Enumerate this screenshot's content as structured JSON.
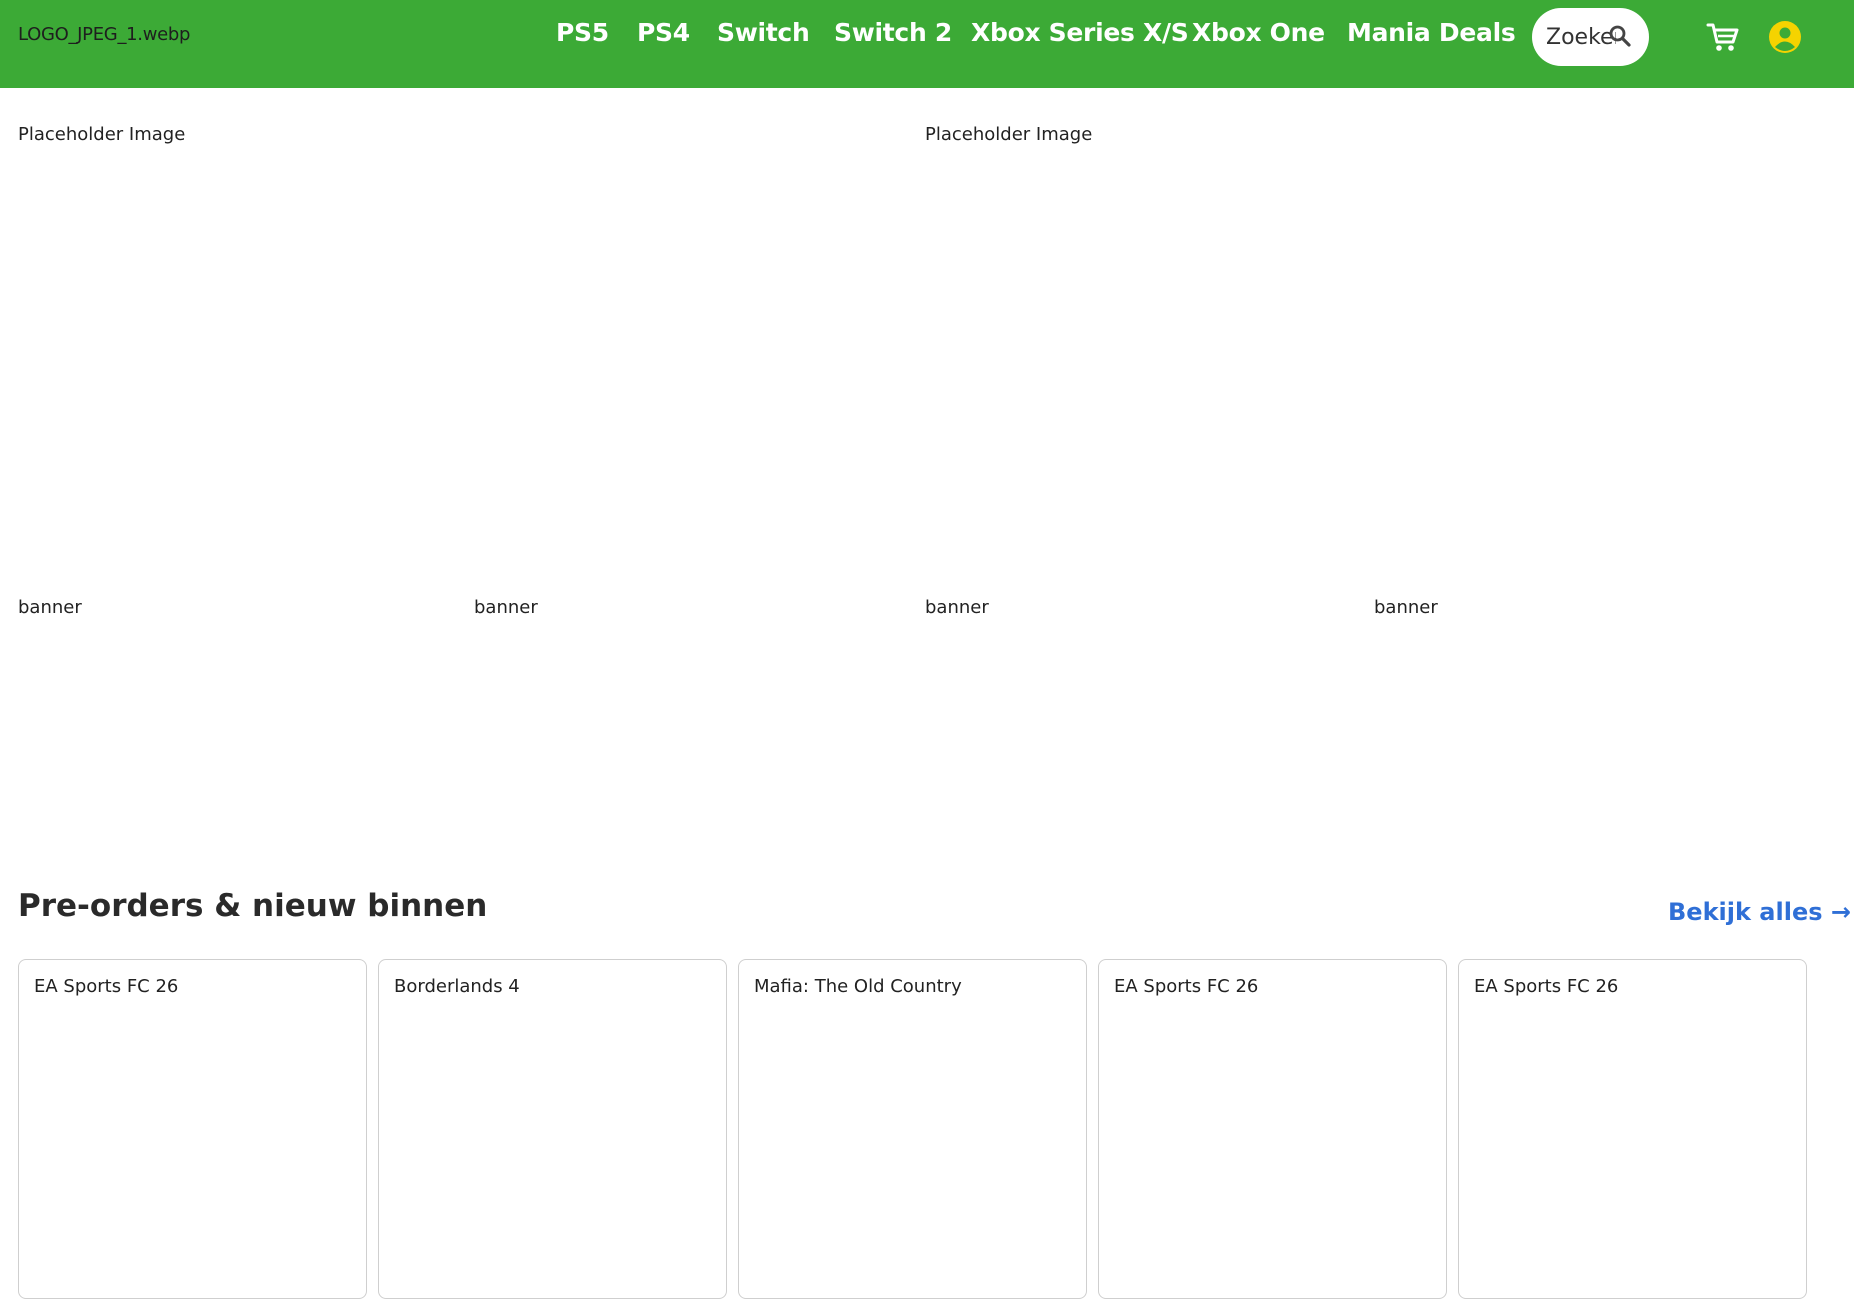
{
  "header": {
    "logo_alt": "LOGO_JPEG_1.webp",
    "background_color": "#3caa36",
    "nav": [
      {
        "label": "PS5"
      },
      {
        "label": "PS4"
      },
      {
        "label": "Switch"
      },
      {
        "label": "Switch 2"
      },
      {
        "label": "Xbox Series X/S"
      },
      {
        "label": "Xbox One"
      },
      {
        "label": "Mania Deals"
      }
    ],
    "search": {
      "placeholder": "Zoeken",
      "value": "",
      "icon": "search-icon"
    },
    "cart_icon": "cart-icon",
    "user_icon": "user-icon",
    "user_icon_color": "#f5d300"
  },
  "hero": {
    "images": [
      {
        "alt": "Placeholder Image"
      },
      {
        "alt": "Placeholder Image"
      }
    ],
    "banners": [
      {
        "alt": "banner"
      },
      {
        "alt": "banner"
      },
      {
        "alt": "banner"
      },
      {
        "alt": "banner"
      }
    ]
  },
  "section": {
    "title": "Pre-orders & nieuw binnen",
    "see_all_label": "Bekijk alles →",
    "link_color": "#2f6fd6",
    "products": [
      {
        "title": "EA Sports FC 26"
      },
      {
        "title": "Borderlands 4"
      },
      {
        "title": "Mafia: The Old Country"
      },
      {
        "title": "EA Sports FC 26"
      },
      {
        "title": "EA Sports FC 26"
      }
    ]
  }
}
